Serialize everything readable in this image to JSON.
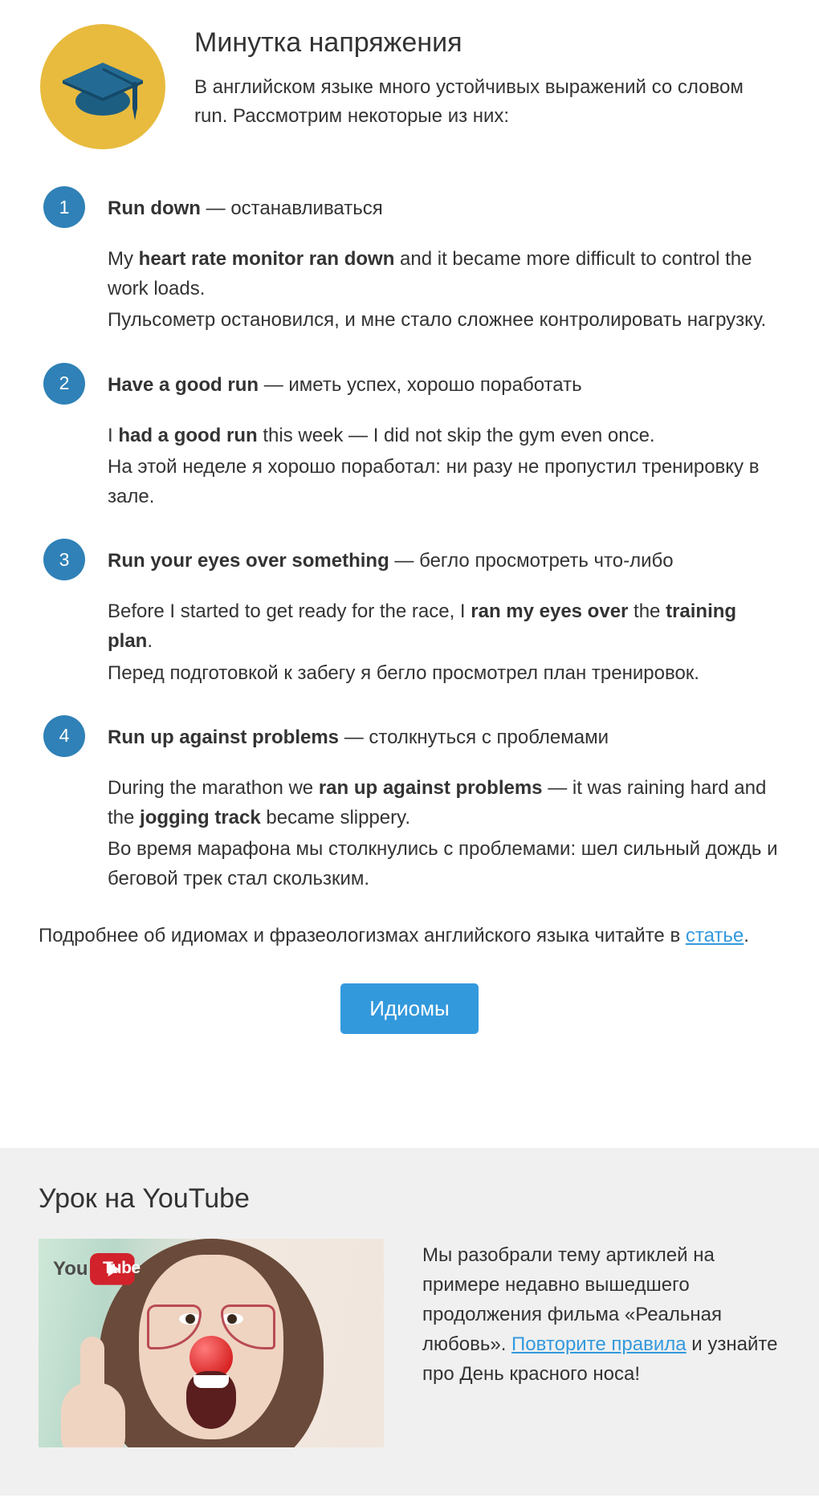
{
  "header": {
    "title": "Минутка напряжения",
    "intro": "В английском языке много устойчивых выражений со словом run. Рассмотрим некоторые из них:",
    "icon": "graduation-cap-icon"
  },
  "items": [
    {
      "num": "1",
      "term": "Run down",
      "dash": " — ",
      "definition": "останавливаться",
      "example_pre": "My ",
      "example_bold": "heart rate monitor ran down",
      "example_post": " and it became more difficult to control the work loads.",
      "translation": "Пульсометр остановился, и мне стало сложнее контролировать нагрузку."
    },
    {
      "num": "2",
      "term": "Have a good run",
      "dash": " — ",
      "definition": "иметь успех, хорошо поработать",
      "example_pre": "I ",
      "example_bold": "had a good run",
      "example_post": " this week — I did not skip the gym even once.",
      "translation": "На этой неделе я хорошо поработал: ни разу не пропустил тренировку в зале."
    },
    {
      "num": "3",
      "term": "Run your eyes over something",
      "dash": " — ",
      "definition": "бегло просмотреть что-либо",
      "example_pre": "Before I started to get ready for the race, I ",
      "example_bold": "ran my eyes over",
      "example_mid": " the ",
      "example_bold2": "training plan",
      "example_post": ".",
      "translation": "Перед подготовкой к забегу я бегло просмотрел план тренировок."
    },
    {
      "num": "4",
      "term": "Run up against problems",
      "dash": " — ",
      "definition": "столкнуться с проблемами",
      "example_pre": "During the marathon we ",
      "example_bold": "ran up against problems",
      "example_mid": " — it was raining hard and the ",
      "example_bold2": "jogging track",
      "example_post": " became slippery.",
      "translation": "Во время марафона мы столкнулись с проблемами: шел сильный дождь и беговой трек стал скользким."
    }
  ],
  "footer": {
    "text_pre": "Подробнее об идиомах и фразеологизмах английского языка читайте в ",
    "link_text": "статье",
    "text_post": "."
  },
  "cta": {
    "label": "Идиомы"
  },
  "youtube": {
    "heading": "Урок на YouTube",
    "logo_text": "Tube",
    "body_pre": "Мы разобрали тему артиклей на примере недавно вышедшего продолжения фильма «Реальная любовь». ",
    "link_text": "Повторите правила",
    "body_post": " и узнайте про День красного носа!",
    "thumb_alt": "youtube-lesson-thumbnail"
  }
}
